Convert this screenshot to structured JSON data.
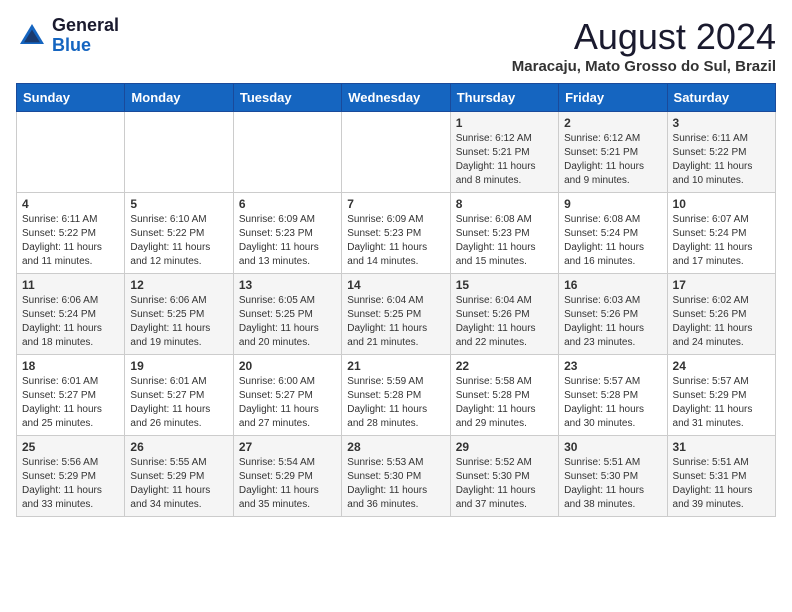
{
  "header": {
    "logo_general": "General",
    "logo_blue": "Blue",
    "month_title": "August 2024",
    "subtitle": "Maracaju, Mato Grosso do Sul, Brazil"
  },
  "weekdays": [
    "Sunday",
    "Monday",
    "Tuesday",
    "Wednesday",
    "Thursday",
    "Friday",
    "Saturday"
  ],
  "weeks": [
    [
      {
        "day": "",
        "info": ""
      },
      {
        "day": "",
        "info": ""
      },
      {
        "day": "",
        "info": ""
      },
      {
        "day": "",
        "info": ""
      },
      {
        "day": "1",
        "info": "Sunrise: 6:12 AM\nSunset: 5:21 PM\nDaylight: 11 hours\nand 8 minutes."
      },
      {
        "day": "2",
        "info": "Sunrise: 6:12 AM\nSunset: 5:21 PM\nDaylight: 11 hours\nand 9 minutes."
      },
      {
        "day": "3",
        "info": "Sunrise: 6:11 AM\nSunset: 5:22 PM\nDaylight: 11 hours\nand 10 minutes."
      }
    ],
    [
      {
        "day": "4",
        "info": "Sunrise: 6:11 AM\nSunset: 5:22 PM\nDaylight: 11 hours\nand 11 minutes."
      },
      {
        "day": "5",
        "info": "Sunrise: 6:10 AM\nSunset: 5:22 PM\nDaylight: 11 hours\nand 12 minutes."
      },
      {
        "day": "6",
        "info": "Sunrise: 6:09 AM\nSunset: 5:23 PM\nDaylight: 11 hours\nand 13 minutes."
      },
      {
        "day": "7",
        "info": "Sunrise: 6:09 AM\nSunset: 5:23 PM\nDaylight: 11 hours\nand 14 minutes."
      },
      {
        "day": "8",
        "info": "Sunrise: 6:08 AM\nSunset: 5:23 PM\nDaylight: 11 hours\nand 15 minutes."
      },
      {
        "day": "9",
        "info": "Sunrise: 6:08 AM\nSunset: 5:24 PM\nDaylight: 11 hours\nand 16 minutes."
      },
      {
        "day": "10",
        "info": "Sunrise: 6:07 AM\nSunset: 5:24 PM\nDaylight: 11 hours\nand 17 minutes."
      }
    ],
    [
      {
        "day": "11",
        "info": "Sunrise: 6:06 AM\nSunset: 5:24 PM\nDaylight: 11 hours\nand 18 minutes."
      },
      {
        "day": "12",
        "info": "Sunrise: 6:06 AM\nSunset: 5:25 PM\nDaylight: 11 hours\nand 19 minutes."
      },
      {
        "day": "13",
        "info": "Sunrise: 6:05 AM\nSunset: 5:25 PM\nDaylight: 11 hours\nand 20 minutes."
      },
      {
        "day": "14",
        "info": "Sunrise: 6:04 AM\nSunset: 5:25 PM\nDaylight: 11 hours\nand 21 minutes."
      },
      {
        "day": "15",
        "info": "Sunrise: 6:04 AM\nSunset: 5:26 PM\nDaylight: 11 hours\nand 22 minutes."
      },
      {
        "day": "16",
        "info": "Sunrise: 6:03 AM\nSunset: 5:26 PM\nDaylight: 11 hours\nand 23 minutes."
      },
      {
        "day": "17",
        "info": "Sunrise: 6:02 AM\nSunset: 5:26 PM\nDaylight: 11 hours\nand 24 minutes."
      }
    ],
    [
      {
        "day": "18",
        "info": "Sunrise: 6:01 AM\nSunset: 5:27 PM\nDaylight: 11 hours\nand 25 minutes."
      },
      {
        "day": "19",
        "info": "Sunrise: 6:01 AM\nSunset: 5:27 PM\nDaylight: 11 hours\nand 26 minutes."
      },
      {
        "day": "20",
        "info": "Sunrise: 6:00 AM\nSunset: 5:27 PM\nDaylight: 11 hours\nand 27 minutes."
      },
      {
        "day": "21",
        "info": "Sunrise: 5:59 AM\nSunset: 5:28 PM\nDaylight: 11 hours\nand 28 minutes."
      },
      {
        "day": "22",
        "info": "Sunrise: 5:58 AM\nSunset: 5:28 PM\nDaylight: 11 hours\nand 29 minutes."
      },
      {
        "day": "23",
        "info": "Sunrise: 5:57 AM\nSunset: 5:28 PM\nDaylight: 11 hours\nand 30 minutes."
      },
      {
        "day": "24",
        "info": "Sunrise: 5:57 AM\nSunset: 5:29 PM\nDaylight: 11 hours\nand 31 minutes."
      }
    ],
    [
      {
        "day": "25",
        "info": "Sunrise: 5:56 AM\nSunset: 5:29 PM\nDaylight: 11 hours\nand 33 minutes."
      },
      {
        "day": "26",
        "info": "Sunrise: 5:55 AM\nSunset: 5:29 PM\nDaylight: 11 hours\nand 34 minutes."
      },
      {
        "day": "27",
        "info": "Sunrise: 5:54 AM\nSunset: 5:29 PM\nDaylight: 11 hours\nand 35 minutes."
      },
      {
        "day": "28",
        "info": "Sunrise: 5:53 AM\nSunset: 5:30 PM\nDaylight: 11 hours\nand 36 minutes."
      },
      {
        "day": "29",
        "info": "Sunrise: 5:52 AM\nSunset: 5:30 PM\nDaylight: 11 hours\nand 37 minutes."
      },
      {
        "day": "30",
        "info": "Sunrise: 5:51 AM\nSunset: 5:30 PM\nDaylight: 11 hours\nand 38 minutes."
      },
      {
        "day": "31",
        "info": "Sunrise: 5:51 AM\nSunset: 5:31 PM\nDaylight: 11 hours\nand 39 minutes."
      }
    ]
  ]
}
